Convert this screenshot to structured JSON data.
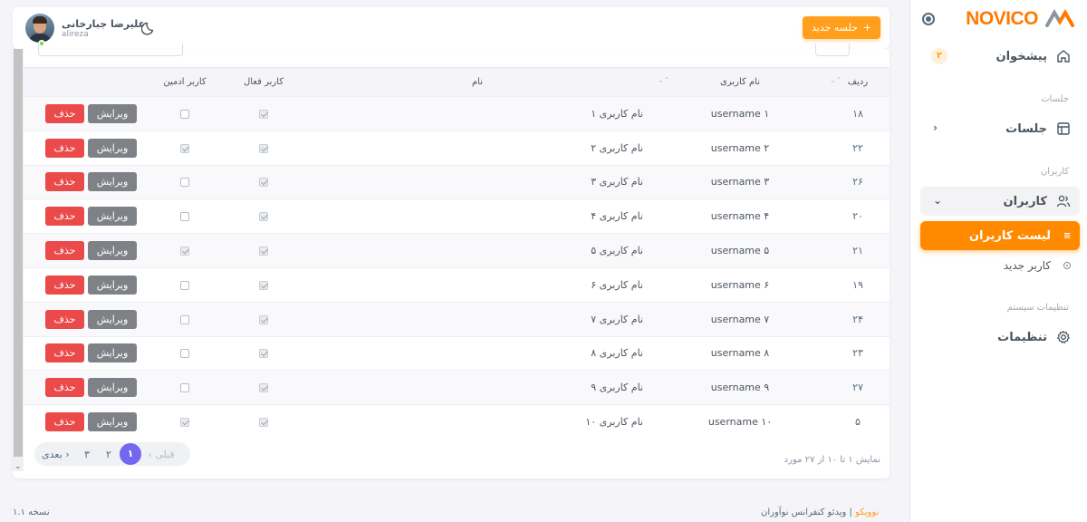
{
  "brand": {
    "name": "NOVICO"
  },
  "sidebar": {
    "dashboard": {
      "label": "پیشخوان",
      "badge": "۲"
    },
    "section_sessions": "جلسات",
    "sessions": {
      "label": "جلسات"
    },
    "section_users": "کاربران",
    "users": {
      "label": "کاربران"
    },
    "user_list": {
      "label": "لیست کاربران"
    },
    "new_user": {
      "label": "کاربر جدید"
    },
    "section_system": "تنظیمات سیستم",
    "settings": {
      "label": "تنظیمات"
    }
  },
  "header": {
    "new_session_label": "جلسه جدید",
    "user": {
      "name": "علیرضا جبارخانی",
      "handle": "alireza"
    }
  },
  "table": {
    "columns": {
      "index": "ردیف",
      "username": "نام کاربری",
      "name": "نام",
      "active": "کاربر فعال",
      "admin": "کاربر ادمین"
    },
    "edit_label": "ویرایش",
    "delete_label": "حذف",
    "rows": [
      {
        "index": "۱۸",
        "username": "username ۱",
        "name": "نام کاربری ۱",
        "active": true,
        "admin": false
      },
      {
        "index": "۲۲",
        "username": "username ۲",
        "name": "نام کاربری ۲",
        "active": true,
        "admin": true
      },
      {
        "index": "۲۶",
        "username": "username ۳",
        "name": "نام کاربری ۳",
        "active": true,
        "admin": false
      },
      {
        "index": "۲۰",
        "username": "username ۴",
        "name": "نام کاربری ۴",
        "active": true,
        "admin": false
      },
      {
        "index": "۲۱",
        "username": "username ۵",
        "name": "نام کاربری ۵",
        "active": true,
        "admin": true
      },
      {
        "index": "۱۹",
        "username": "username ۶",
        "name": "نام کاربری ۶",
        "active": true,
        "admin": false
      },
      {
        "index": "۲۴",
        "username": "username ۷",
        "name": "نام کاربری ۷",
        "active": true,
        "admin": false
      },
      {
        "index": "۲۳",
        "username": "username ۸",
        "name": "نام کاربری ۸",
        "active": true,
        "admin": false
      },
      {
        "index": "۲۷",
        "username": "username ۹",
        "name": "نام کاربری ۹",
        "active": true,
        "admin": false
      },
      {
        "index": "۵",
        "username": "username ۱۰",
        "name": "نام کاربری ۱۰",
        "active": true,
        "admin": true
      }
    ]
  },
  "pagination": {
    "summary": "نمایش ۱ تا ۱۰ از ۲۷ مورد",
    "prev_label": "‹ قبلی",
    "next_label": "بعدی ›",
    "pages": [
      "۱",
      "۲",
      "۳"
    ],
    "current": "۱"
  },
  "footer": {
    "version": "نسخه ۱.۱",
    "brand_link": "نوویکو",
    "tagline": " | ویدئو کنفرانس نوآوران"
  },
  "colors": {
    "accent": "#ff8a00",
    "danger": "#ea4a4a",
    "primary": "#7367f0"
  }
}
